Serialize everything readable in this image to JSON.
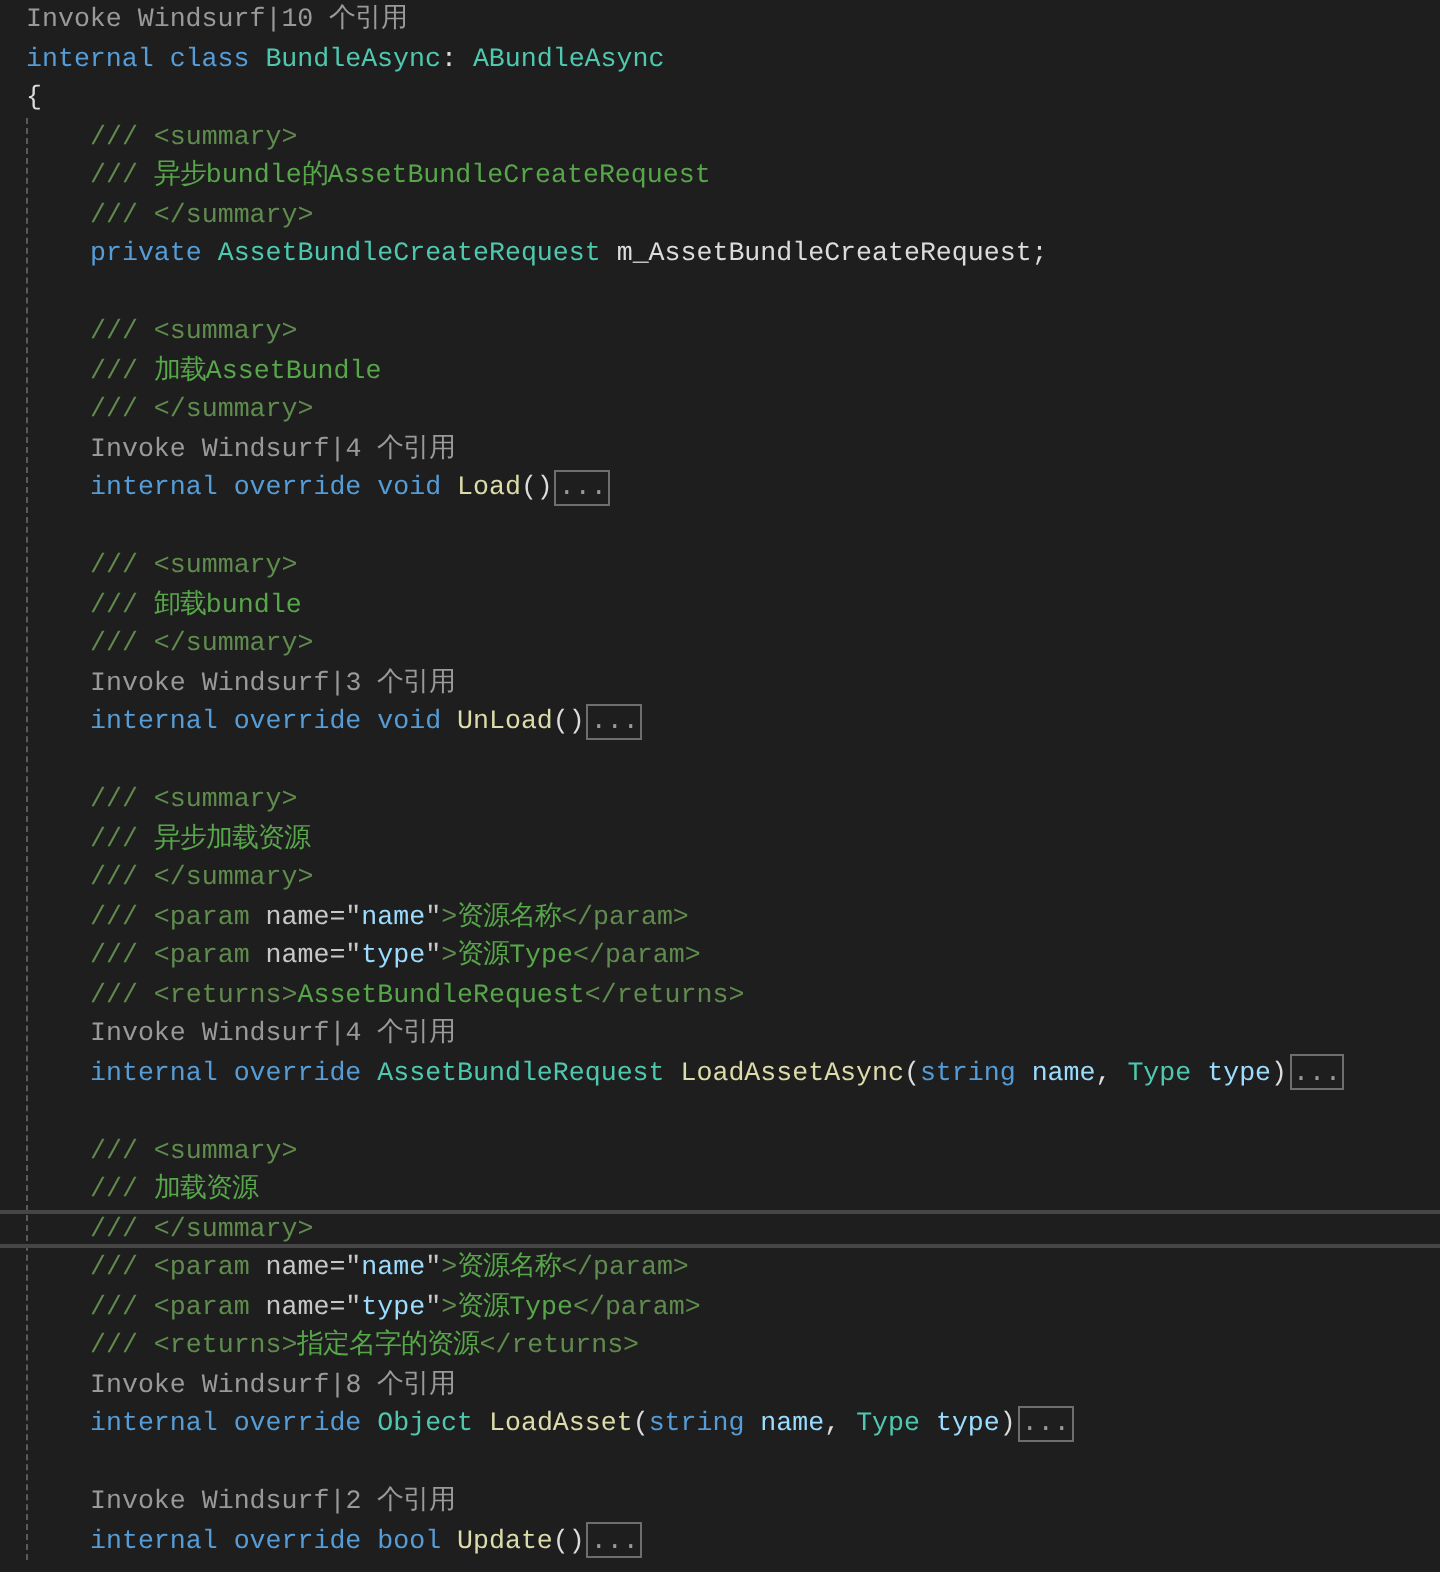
{
  "lines": [
    {
      "kind": "codelens",
      "links": [
        "Invoke Windsurf",
        "10 个引用"
      ],
      "separator": "|"
    },
    {
      "kind": "code",
      "tokens": [
        {
          "kind": "kw",
          "text": "internal class "
        },
        {
          "kind": "type",
          "text": "BundleAsync"
        },
        {
          "kind": "plain",
          "text": ": "
        },
        {
          "kind": "type",
          "text": "ABundleAsync"
        }
      ]
    },
    {
      "kind": "code",
      "tokens": [
        {
          "kind": "plain",
          "text": "{"
        }
      ],
      "children": [
        {
          "kind": "code",
          "current": false,
          "tokens": [
            {
              "kind": "doc",
              "text": "/// <summary>"
            }
          ]
        },
        {
          "kind": "code",
          "current": false,
          "tokens": [
            {
              "kind": "doc",
              "text": "/// "
            },
            {
              "kind": "doctext",
              "text": "异步bundle的AssetBundleCreateRequest"
            }
          ]
        },
        {
          "kind": "code",
          "current": false,
          "tokens": [
            {
              "kind": "doc",
              "text": "/// </summary>"
            }
          ]
        },
        {
          "kind": "code",
          "current": false,
          "tokens": [
            {
              "kind": "kw",
              "text": "private "
            },
            {
              "kind": "type",
              "text": "AssetBundleCreateRequest"
            },
            {
              "kind": "plain",
              "text": " m_AssetBundleCreateRequest;"
            }
          ]
        },
        {
          "kind": "blank",
          "current": false
        },
        {
          "kind": "code",
          "current": false,
          "tokens": [
            {
              "kind": "doc",
              "text": "/// <summary>"
            }
          ]
        },
        {
          "kind": "code",
          "current": false,
          "tokens": [
            {
              "kind": "doc",
              "text": "/// "
            },
            {
              "kind": "doctext",
              "text": "加载AssetBundle"
            }
          ]
        },
        {
          "kind": "code",
          "current": false,
          "tokens": [
            {
              "kind": "doc",
              "text": "/// </summary>"
            }
          ]
        },
        {
          "kind": "codelens",
          "current": false,
          "links": [
            "Invoke Windsurf",
            "4 个引用"
          ],
          "separator": "|"
        },
        {
          "kind": "code",
          "current": false,
          "tokens": [
            {
              "kind": "kw",
              "text": "internal override void "
            },
            {
              "kind": "method",
              "text": "Load"
            },
            {
              "kind": "plain",
              "text": "()"
            }
          ],
          "fold": "..."
        },
        {
          "kind": "blank",
          "current": false
        },
        {
          "kind": "code",
          "current": false,
          "tokens": [
            {
              "kind": "doc",
              "text": "/// <summary>"
            }
          ]
        },
        {
          "kind": "code",
          "current": false,
          "tokens": [
            {
              "kind": "doc",
              "text": "/// "
            },
            {
              "kind": "doctext",
              "text": "卸载bundle"
            }
          ]
        },
        {
          "kind": "code",
          "current": false,
          "tokens": [
            {
              "kind": "doc",
              "text": "/// </summary>"
            }
          ]
        },
        {
          "kind": "codelens",
          "current": false,
          "links": [
            "Invoke Windsurf",
            "3 个引用"
          ],
          "separator": "|"
        },
        {
          "kind": "code",
          "current": false,
          "tokens": [
            {
              "kind": "kw",
              "text": "internal override void "
            },
            {
              "kind": "method",
              "text": "UnLoad"
            },
            {
              "kind": "plain",
              "text": "()"
            }
          ],
          "fold": "..."
        },
        {
          "kind": "blank",
          "current": false
        },
        {
          "kind": "code",
          "current": false,
          "tokens": [
            {
              "kind": "doc",
              "text": "/// <summary>"
            }
          ]
        },
        {
          "kind": "code",
          "current": false,
          "tokens": [
            {
              "kind": "doc",
              "text": "/// "
            },
            {
              "kind": "doctext",
              "text": "异步加载资源"
            }
          ]
        },
        {
          "kind": "code",
          "current": false,
          "tokens": [
            {
              "kind": "doc",
              "text": "/// </summary>"
            }
          ]
        },
        {
          "kind": "code",
          "current": false,
          "tokens": [
            {
              "kind": "doc",
              "text": "/// <param "
            },
            {
              "kind": "attr",
              "text": "name=\""
            },
            {
              "kind": "attrval",
              "text": "name"
            },
            {
              "kind": "attr",
              "text": "\""
            },
            {
              "kind": "doc",
              "text": ">"
            },
            {
              "kind": "doctext",
              "text": "资源名称"
            },
            {
              "kind": "doc",
              "text": "</param>"
            }
          ]
        },
        {
          "kind": "code",
          "current": false,
          "tokens": [
            {
              "kind": "doc",
              "text": "/// <param "
            },
            {
              "kind": "attr",
              "text": "name=\""
            },
            {
              "kind": "attrval",
              "text": "type"
            },
            {
              "kind": "attr",
              "text": "\""
            },
            {
              "kind": "doc",
              "text": ">"
            },
            {
              "kind": "doctext",
              "text": "资源Type"
            },
            {
              "kind": "doc",
              "text": "</param>"
            }
          ]
        },
        {
          "kind": "code",
          "current": false,
          "tokens": [
            {
              "kind": "doc",
              "text": "/// <returns>"
            },
            {
              "kind": "doctext",
              "text": "AssetBundleRequest"
            },
            {
              "kind": "doc",
              "text": "</returns>"
            }
          ]
        },
        {
          "kind": "codelens",
          "current": false,
          "links": [
            "Invoke Windsurf",
            "4 个引用"
          ],
          "separator": "|"
        },
        {
          "kind": "code",
          "current": false,
          "tokens": [
            {
              "kind": "kw",
              "text": "internal override "
            },
            {
              "kind": "type",
              "text": "AssetBundleRequest "
            },
            {
              "kind": "method",
              "text": "LoadAssetAsync"
            },
            {
              "kind": "plain",
              "text": "("
            },
            {
              "kind": "kw",
              "text": "string "
            },
            {
              "kind": "param",
              "text": "name"
            },
            {
              "kind": "plain",
              "text": ", "
            },
            {
              "kind": "type",
              "text": "Type "
            },
            {
              "kind": "param",
              "text": "type"
            },
            {
              "kind": "plain",
              "text": ")"
            }
          ],
          "fold": "..."
        },
        {
          "kind": "blank",
          "current": false
        },
        {
          "kind": "code",
          "current": false,
          "tokens": [
            {
              "kind": "doc",
              "text": "/// <summary>"
            }
          ]
        },
        {
          "kind": "code",
          "current": false,
          "tokens": [
            {
              "kind": "doc",
              "text": "/// "
            },
            {
              "kind": "doctext",
              "text": "加载资源"
            }
          ]
        },
        {
          "kind": "code",
          "current": true,
          "tokens": [
            {
              "kind": "doc",
              "text": "/// </summary>"
            }
          ]
        },
        {
          "kind": "code",
          "current": false,
          "tokens": [
            {
              "kind": "doc",
              "text": "/// <param "
            },
            {
              "kind": "attr",
              "text": "name=\""
            },
            {
              "kind": "attrval",
              "text": "name"
            },
            {
              "kind": "attr",
              "text": "\""
            },
            {
              "kind": "doc",
              "text": ">"
            },
            {
              "kind": "doctext",
              "text": "资源名称"
            },
            {
              "kind": "doc",
              "text": "</param>"
            }
          ]
        },
        {
          "kind": "code",
          "current": false,
          "tokens": [
            {
              "kind": "doc",
              "text": "/// <param "
            },
            {
              "kind": "attr",
              "text": "name=\""
            },
            {
              "kind": "attrval",
              "text": "type"
            },
            {
              "kind": "attr",
              "text": "\""
            },
            {
              "kind": "doc",
              "text": ">"
            },
            {
              "kind": "doctext",
              "text": "资源Type"
            },
            {
              "kind": "doc",
              "text": "</param>"
            }
          ]
        },
        {
          "kind": "code",
          "current": false,
          "tokens": [
            {
              "kind": "doc",
              "text": "/// <returns>"
            },
            {
              "kind": "doctext",
              "text": "指定名字的资源"
            },
            {
              "kind": "doc",
              "text": "</returns>"
            }
          ]
        },
        {
          "kind": "codelens",
          "current": false,
          "links": [
            "Invoke Windsurf",
            "8 个引用"
          ],
          "separator": "|"
        },
        {
          "kind": "code",
          "current": false,
          "tokens": [
            {
              "kind": "kw",
              "text": "internal override "
            },
            {
              "kind": "type",
              "text": "Object "
            },
            {
              "kind": "method",
              "text": "LoadAsset"
            },
            {
              "kind": "plain",
              "text": "("
            },
            {
              "kind": "kw",
              "text": "string "
            },
            {
              "kind": "param",
              "text": "name"
            },
            {
              "kind": "plain",
              "text": ", "
            },
            {
              "kind": "type",
              "text": "Type "
            },
            {
              "kind": "param",
              "text": "type"
            },
            {
              "kind": "plain",
              "text": ")"
            }
          ],
          "fold": "..."
        },
        {
          "kind": "blank",
          "current": false
        },
        {
          "kind": "codelens",
          "current": false,
          "links": [
            "Invoke Windsurf",
            "2 个引用"
          ],
          "separator": "|"
        },
        {
          "kind": "code",
          "current": false,
          "tokens": [
            {
              "kind": "kw",
              "text": "internal override bool "
            },
            {
              "kind": "method",
              "text": "Update"
            },
            {
              "kind": "plain",
              "text": "()"
            }
          ],
          "fold": "..."
        }
      ]
    }
  ]
}
